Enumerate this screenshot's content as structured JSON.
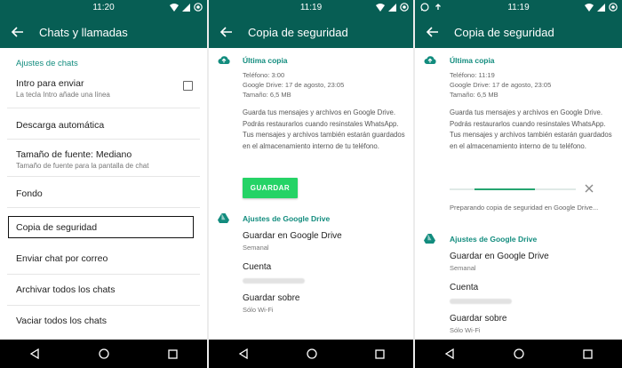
{
  "colors": {
    "header": "#075e54",
    "accent": "#128c7e",
    "button": "#25d366"
  },
  "screen1": {
    "status": {
      "time": "11:20"
    },
    "title": "Chats y llamadas",
    "section": "Ajustes de chats",
    "items": [
      {
        "label": "Intro para enviar",
        "sub": "La tecla Intro añade una línea"
      },
      {
        "label": "Descarga automática"
      },
      {
        "label": "Tamaño de fuente: Mediano",
        "sub": "Tamaño de fuente para la pantalla de chat"
      },
      {
        "label": "Fondo"
      },
      {
        "label": "Copia de seguridad"
      },
      {
        "label": "Enviar chat por correo"
      },
      {
        "label": "Archivar todos los chats"
      },
      {
        "label": "Vaciar todos los chats"
      }
    ]
  },
  "screen2": {
    "status": {
      "time": "11:19"
    },
    "title": "Copia de seguridad",
    "last_backup": {
      "heading": "Última copia",
      "phone": "Teléfono: 3:00",
      "drive": "Google Drive: 17 de agosto, 23:05",
      "size": "Tamaño: 6,5 MB"
    },
    "description": "Guarda tus mensajes y archivos en Google Drive. Podrás restaurarlos cuando resinstales WhatsApp. Tus mensajes y archivos también estarán guardados en el almacenamiento interno de tu teléfono.",
    "button": "GUARDAR",
    "drive_section": "Ajustes de Google Drive",
    "settings": [
      {
        "label": "Guardar en Google Drive",
        "sub": "Semanal"
      },
      {
        "label": "Cuenta",
        "sub": ""
      },
      {
        "label": "Guardar sobre",
        "sub": "Sólo Wi-Fi"
      }
    ]
  },
  "screen3": {
    "status": {
      "time": "11:19"
    },
    "title": "Copia de seguridad",
    "last_backup": {
      "heading": "Última copia",
      "phone": "Teléfono: 11:19",
      "drive": "Google Drive: 17 de agosto, 23:05",
      "size": "Tamaño: 6,5 MB"
    },
    "description": "Guarda tus mensajes y archivos en Google Drive. Podrás restaurarlos cuando resinstales WhatsApp. Tus mensajes y archivos también estarán guardados en el almacenamiento interno de tu teléfono.",
    "progress": {
      "fraction": 0.6,
      "status": "Preparando copia de seguridad en Google Drive..."
    },
    "drive_section": "Ajustes de Google Drive",
    "settings": [
      {
        "label": "Guardar en Google Drive",
        "sub": "Semanal"
      },
      {
        "label": "Cuenta",
        "sub": ""
      },
      {
        "label": "Guardar sobre",
        "sub": "Sólo Wi-Fi"
      }
    ]
  }
}
